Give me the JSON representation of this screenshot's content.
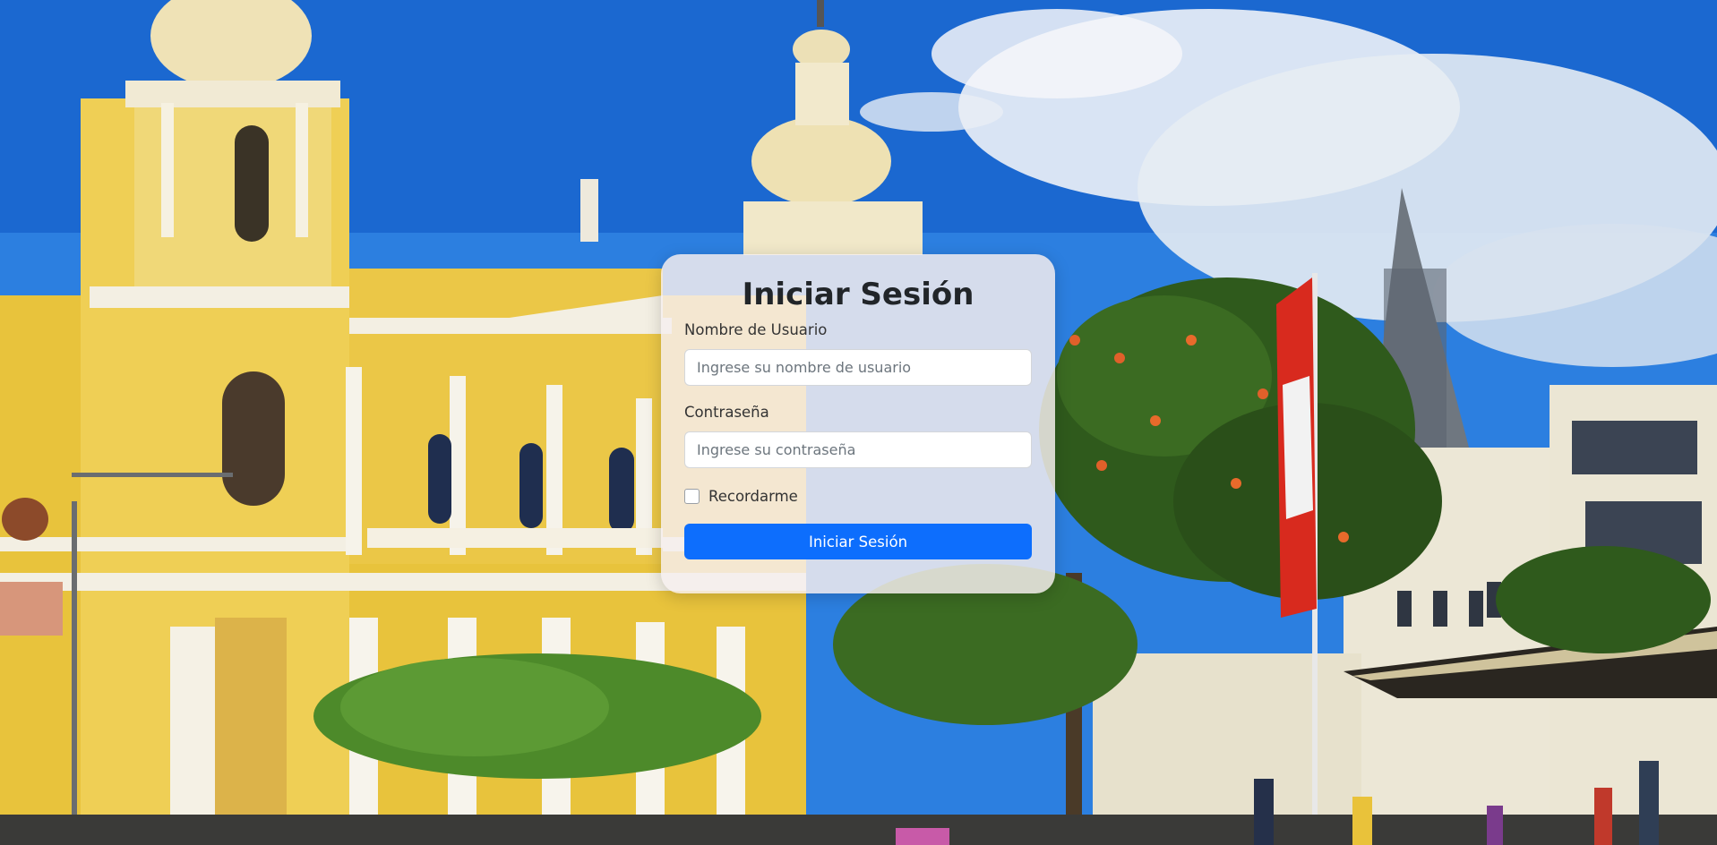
{
  "login": {
    "title": "Iniciar Sesión",
    "username_label": "Nombre de Usuario",
    "username_placeholder": "Ingrese su nombre de usuario",
    "username_value": "",
    "password_label": "Contraseña",
    "password_placeholder": "Ingrese su contraseña",
    "password_value": "",
    "remember_label": "Recordarme",
    "remember_checked": false,
    "submit_label": "Iniciar Sesión"
  },
  "colors": {
    "primary": "#0d6efd",
    "card_bg": "#f5eeee",
    "sky": "#1f6fd6",
    "cathedral": "#e8c33c"
  }
}
